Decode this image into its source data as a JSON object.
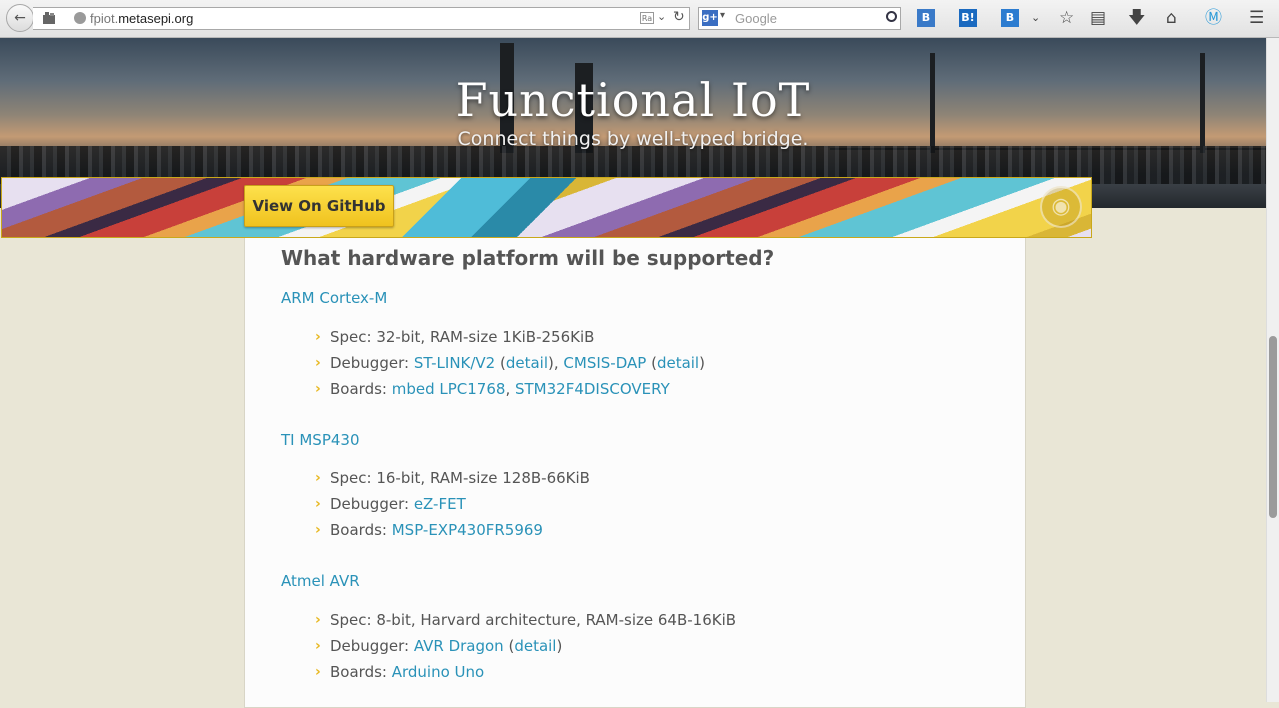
{
  "browser": {
    "url_host": "fpiot.",
    "url_domain": "metasepi.org",
    "search_placeholder": "Google",
    "search_engine_glyph": "g+",
    "reader_glyph": "Ra",
    "ext_icons": [
      "B",
      "B!",
      "B"
    ],
    "colors": {
      "accent": "#2a92b8"
    }
  },
  "hero": {
    "title": "Functional IoT",
    "subtitle": "Connect things by well-typed bridge."
  },
  "banner": {
    "github_label": "View On GitHub"
  },
  "content": {
    "section_title": "What hardware platform will be supported?",
    "platforms": [
      {
        "name": "ARM Cortex-M",
        "spec": "Spec: 32-bit, RAM-size 1KiB-256KiB",
        "debugger_label": "Debugger: ",
        "debuggers": [
          "ST-LINK/V2",
          "detail",
          "CMSIS-DAP",
          "detail"
        ],
        "boards_label": "Boards: ",
        "boards": [
          "mbed LPC1768",
          "STM32F4DISCOVERY"
        ]
      },
      {
        "name": "TI MSP430",
        "spec": "Spec: 16-bit, RAM-size 128B-66KiB",
        "debugger_label": "Debugger: ",
        "debuggers": [
          "eZ-FET"
        ],
        "boards_label": "Boards: ",
        "boards": [
          "MSP-EXP430FR5969"
        ]
      },
      {
        "name": "Atmel AVR",
        "spec": "Spec: 8-bit, Harvard architecture, RAM-size 64B-16KiB",
        "debugger_label": "Debugger: ",
        "debuggers": [
          "AVR Dragon",
          "detail"
        ],
        "boards_label": "Boards: ",
        "boards": [
          "Arduino Uno"
        ]
      }
    ]
  }
}
